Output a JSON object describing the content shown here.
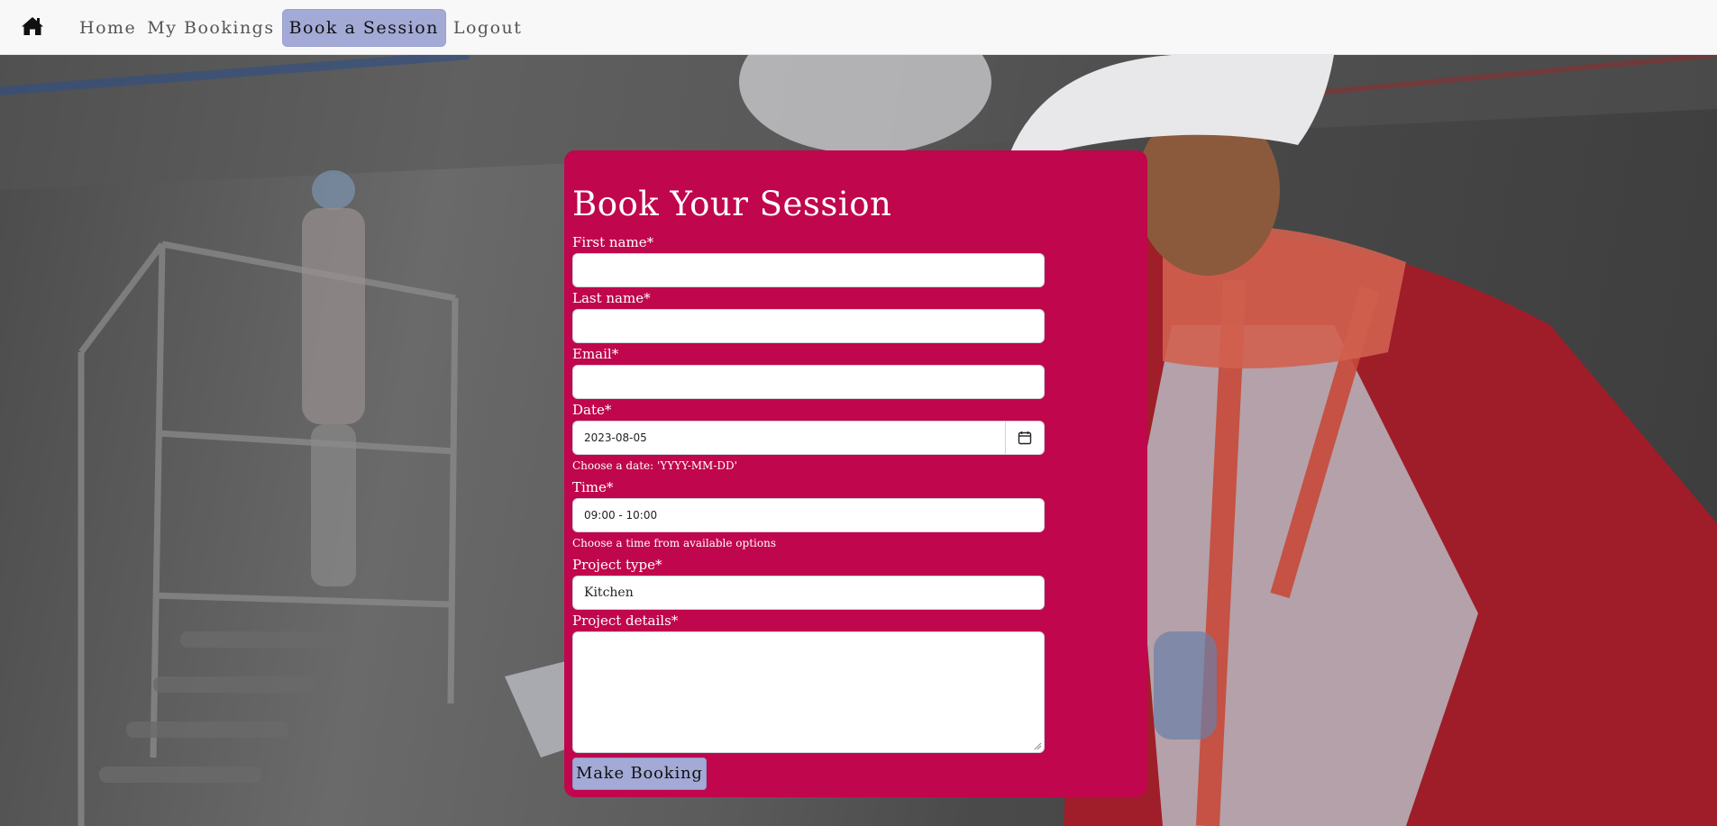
{
  "nav": {
    "home_icon": "home-icon",
    "items": [
      {
        "label": "Home",
        "active": false
      },
      {
        "label": "My Bookings",
        "active": false
      },
      {
        "label": "Book a Session",
        "active": true
      },
      {
        "label": "Logout",
        "active": false
      }
    ],
    "active_color": "#a3aad6"
  },
  "form": {
    "title": "Book Your Session",
    "accent_color": "#c0064c",
    "first_name": {
      "label": "First name*",
      "value": ""
    },
    "last_name": {
      "label": "Last name*",
      "value": ""
    },
    "email": {
      "label": "Email*",
      "value": ""
    },
    "date": {
      "label": "Date*",
      "value": "2023-08-05",
      "help": "Choose a date: 'YYYY-MM-DD'",
      "icon": "calendar-icon"
    },
    "time": {
      "label": "Time*",
      "value": "09:00 - 10:00",
      "help": "Choose a time from available options"
    },
    "project_type": {
      "label": "Project type*",
      "value": "Kitchen"
    },
    "project_details": {
      "label": "Project details*",
      "value": ""
    },
    "submit_label": "Make Booking"
  }
}
